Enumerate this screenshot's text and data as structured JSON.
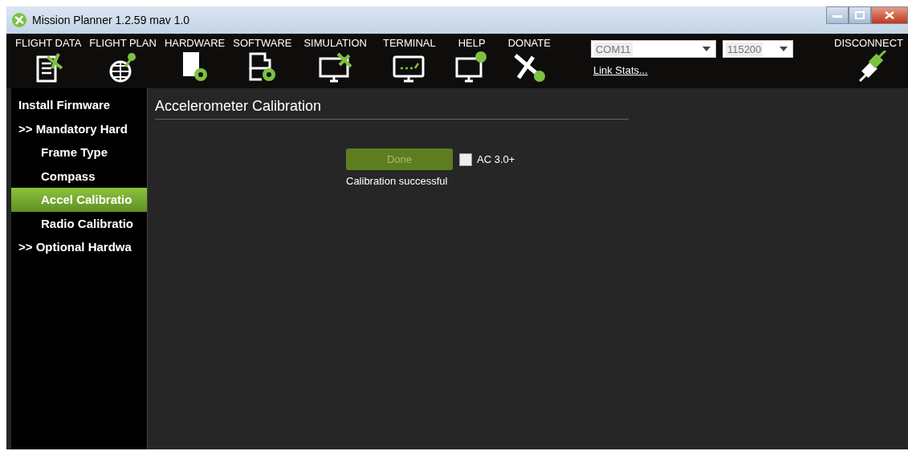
{
  "window": {
    "title": "Mission Planner 1.2.59 mav 1.0"
  },
  "menu": [
    {
      "label": "FLIGHT DATA"
    },
    {
      "label": "FLIGHT PLAN"
    },
    {
      "label": "HARDWARE"
    },
    {
      "label": "SOFTWARE"
    },
    {
      "label": "SIMULATION"
    },
    {
      "label": "TERMINAL"
    },
    {
      "label": "HELP"
    },
    {
      "label": "DONATE"
    }
  ],
  "connection": {
    "port": "COM11",
    "baud": "115200",
    "link_stats": "Link Stats...",
    "disconnect": "DISCONNECT"
  },
  "sidebar": {
    "items": [
      {
        "label": "Install Firmware",
        "selected": false
      },
      {
        "label": ">> Mandatory Hard",
        "selected": false,
        "children": [
          {
            "label": "Frame Type",
            "selected": false
          },
          {
            "label": "Compass",
            "selected": false
          },
          {
            "label": "Accel Calibratio",
            "selected": true
          },
          {
            "label": "Radio Calibratio",
            "selected": false
          }
        ]
      },
      {
        "label": ">> Optional Hardwa",
        "selected": false
      }
    ]
  },
  "panel": {
    "title": "Accelerometer Calibration",
    "button": {
      "label": "Done",
      "disabled": true
    },
    "checkbox": {
      "label": "AC 3.0+",
      "checked": false
    },
    "status": "Calibration successful"
  }
}
